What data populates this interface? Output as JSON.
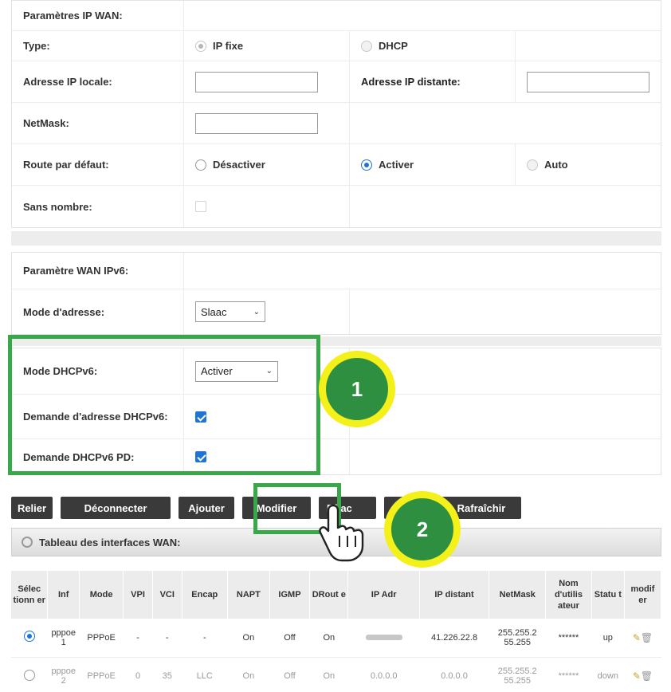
{
  "ipv4": {
    "section_title": "Paramètres IP WAN:",
    "type_label": "Type:",
    "type_opt_fixed": "IP fixe",
    "type_opt_dhcp": "DHCP",
    "local_ip_label": "Adresse IP locale:",
    "remote_ip_label": "Adresse IP distante:",
    "netmask_label": "NetMask:",
    "default_route_label": "Route par défaut:",
    "route_opt_disable": "Désactiver",
    "route_opt_enable": "Activer",
    "route_opt_auto": "Auto",
    "unnumbered_label": "Sans nombre:"
  },
  "ipv6": {
    "section_title": "Paramètre WAN IPv6:",
    "addr_mode_label": "Mode d'adresse:",
    "addr_mode_value": "Slaac",
    "dhcpv6_mode_label": "Mode DHCPv6:",
    "dhcpv6_mode_value": "Activer",
    "dhcpv6_addr_req_label": "Demande d'adresse DHCPv6:",
    "dhcpv6_pd_label": "Demande DHCPv6 PD:"
  },
  "toolbar": {
    "relier": "Relier",
    "deconnecter": "Déconnecter",
    "ajouter": "Ajouter",
    "modifier": "Modifier",
    "effacer": "Effac",
    "importer": "er",
    "rafraichir": "Rafraîchir"
  },
  "table": {
    "title": "Tableau des interfaces WAN:",
    "headers": [
      "Sélec tionn er",
      "Inf",
      "Mode",
      "VPI",
      "VCI",
      "Encap",
      "NAPT",
      "IGMP",
      "DRout e",
      "IP Adr",
      "IP distant",
      "NetMask",
      "Nom d'utilis ateur",
      "Statu t",
      "modif er"
    ],
    "rows": [
      {
        "inf": "pppoe 1",
        "mode": "PPPoE",
        "vpi": "-",
        "vci": "-",
        "encap": "-",
        "napt": "On",
        "igmp": "Off",
        "droute": "On",
        "ip_adr": "",
        "ip_distant": "41.226.22.8",
        "netmask": "255.255.2 55.255",
        "user": "******",
        "status": "up"
      },
      {
        "inf": "pppoe 2",
        "mode": "PPPoE",
        "vpi": "0",
        "vci": "35",
        "encap": "LLC",
        "napt": "On",
        "igmp": "Off",
        "droute": "On",
        "ip_adr": "0.0.0.0",
        "ip_distant": "0.0.0.0",
        "netmask": "255.255.2 55.255",
        "user": "******",
        "status": "down"
      }
    ]
  },
  "annotations": {
    "badge1": "1",
    "badge2": "2",
    "accent_green": "#3aa84a",
    "badge_yellow": "#f4f01a"
  }
}
